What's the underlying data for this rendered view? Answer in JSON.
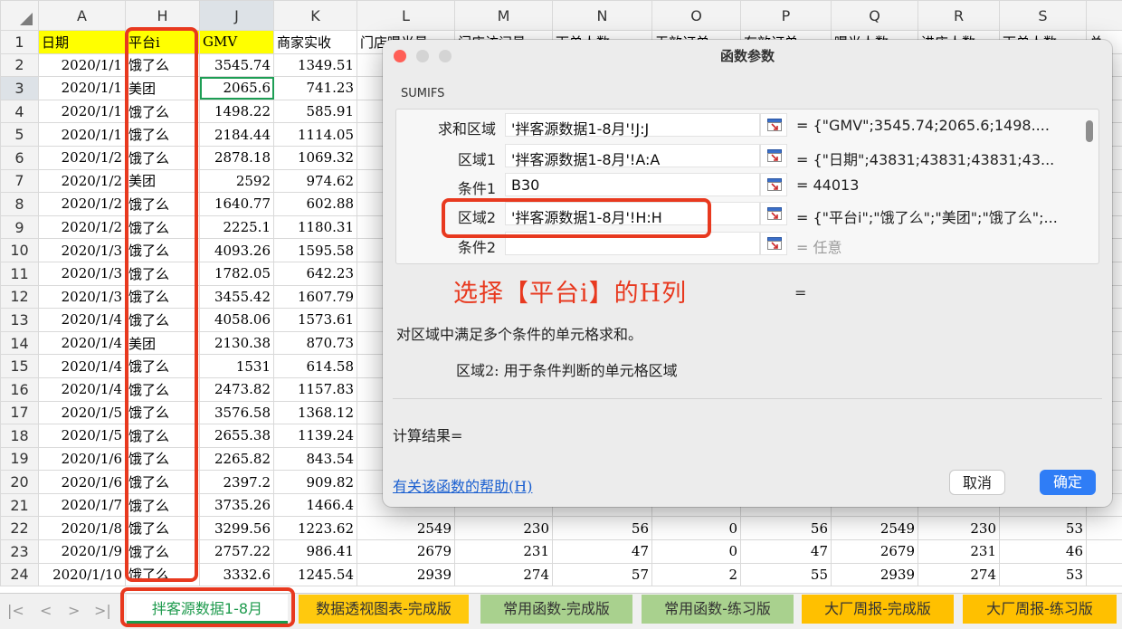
{
  "columns": [
    "A",
    "H",
    "J",
    "K",
    "L",
    "M",
    "N",
    "O",
    "P",
    "Q",
    "R",
    "S"
  ],
  "header_row": {
    "row": "1",
    "A": "日期",
    "H": "平台i",
    "J": "GMV",
    "K": "商家实收",
    "L": "门店曝光量",
    "M": "门店访问量",
    "N": "下单人数",
    "O": "无效订单",
    "P": "有效订单",
    "Q": "曝光人数",
    "R": "进店人数",
    "S": "下单人数",
    "T": "总"
  },
  "rows": [
    {
      "n": "2",
      "A": "2020/1/1",
      "H": "饿了么",
      "J": "3545.74",
      "K": "1349.51"
    },
    {
      "n": "3",
      "A": "2020/1/1",
      "H": "美团",
      "J": "2065.6",
      "K": "741.23"
    },
    {
      "n": "4",
      "A": "2020/1/1",
      "H": "饿了么",
      "J": "1498.22",
      "K": "585.91"
    },
    {
      "n": "5",
      "A": "2020/1/1",
      "H": "饿了么",
      "J": "2184.44",
      "K": "1114.05"
    },
    {
      "n": "6",
      "A": "2020/1/2",
      "H": "饿了么",
      "J": "2878.18",
      "K": "1069.32"
    },
    {
      "n": "7",
      "A": "2020/1/2",
      "H": "美团",
      "J": "2592",
      "K": "974.62"
    },
    {
      "n": "8",
      "A": "2020/1/2",
      "H": "饿了么",
      "J": "1640.77",
      "K": "602.88"
    },
    {
      "n": "9",
      "A": "2020/1/2",
      "H": "饿了么",
      "J": "2225.1",
      "K": "1180.31"
    },
    {
      "n": "10",
      "A": "2020/1/3",
      "H": "饿了么",
      "J": "4093.26",
      "K": "1595.58"
    },
    {
      "n": "11",
      "A": "2020/1/3",
      "H": "饿了么",
      "J": "1782.05",
      "K": "642.23"
    },
    {
      "n": "12",
      "A": "2020/1/3",
      "H": "饿了么",
      "J": "3455.42",
      "K": "1607.79"
    },
    {
      "n": "13",
      "A": "2020/1/4",
      "H": "饿了么",
      "J": "4058.06",
      "K": "1573.61"
    },
    {
      "n": "14",
      "A": "2020/1/4",
      "H": "美团",
      "J": "2130.38",
      "K": "870.73"
    },
    {
      "n": "15",
      "A": "2020/1/4",
      "H": "饿了么",
      "J": "1531",
      "K": "614.58"
    },
    {
      "n": "16",
      "A": "2020/1/4",
      "H": "饿了么",
      "J": "2473.82",
      "K": "1157.83"
    },
    {
      "n": "17",
      "A": "2020/1/5",
      "H": "饿了么",
      "J": "3576.58",
      "K": "1368.12"
    },
    {
      "n": "18",
      "A": "2020/1/5",
      "H": "饿了么",
      "J": "2655.38",
      "K": "1139.24"
    },
    {
      "n": "19",
      "A": "2020/1/6",
      "H": "饿了么",
      "J": "2265.82",
      "K": "843.54"
    },
    {
      "n": "20",
      "A": "2020/1/6",
      "H": "饿了么",
      "J": "2397.2",
      "K": "909.82"
    },
    {
      "n": "21",
      "A": "2020/1/7",
      "H": "饿了么",
      "J": "3735.26",
      "K": "1466.4",
      "L": "",
      "M": "",
      "N": "",
      "O": "",
      "P": "",
      "Q": "",
      "R": "",
      "S": ""
    },
    {
      "n": "22",
      "A": "2020/1/8",
      "H": "饿了么",
      "J": "3299.56",
      "K": "1223.62",
      "L": "2549",
      "M": "230",
      "N": "56",
      "O": "0",
      "P": "56",
      "Q": "2549",
      "R": "230",
      "S": "53"
    },
    {
      "n": "23",
      "A": "2020/1/9",
      "H": "饿了么",
      "J": "2757.22",
      "K": "986.41",
      "L": "2679",
      "M": "231",
      "N": "47",
      "O": "0",
      "P": "47",
      "Q": "2679",
      "R": "231",
      "S": "46"
    },
    {
      "n": "24",
      "A": "2020/1/10",
      "H": "饿了么",
      "J": "3332.6",
      "K": "1245.54",
      "L": "2939",
      "M": "274",
      "N": "57",
      "O": "2",
      "P": "55",
      "Q": "2939",
      "R": "274",
      "S": "53"
    }
  ],
  "dialog": {
    "title": "函数参数",
    "function_name": "SUMIFS",
    "args": [
      {
        "label": "求和区域",
        "value": "'拌客源数据1-8月'!J:J",
        "result": "= {\"GMV\";3545.74;2065.6;1498...."
      },
      {
        "label": "区域1",
        "value": "'拌客源数据1-8月'!A:A",
        "result": "= {\"日期\";43831;43831;43831;43..."
      },
      {
        "label": "条件1",
        "value": "B30",
        "result": "= 44013"
      },
      {
        "label": "区域2",
        "value": "'拌客源数据1-8月'!H:H",
        "result": "= {\"平台i\";\"饿了么\";\"美团\";\"饿了么\";..."
      },
      {
        "label": "条件2",
        "value": "",
        "result": "= 任意"
      }
    ],
    "equals": "=",
    "description": "对区域中满足多个条件的单元格求和。",
    "arg_help": "区域2: 用于条件判断的单元格区域",
    "calc_result": "计算结果=",
    "help_link": "有关该函数的帮助(H)",
    "cancel_label": "取消",
    "ok_label": "确定"
  },
  "annotation": "选择【平台i】的H列",
  "sheet_tabs": [
    "拌客源数据1-8月",
    "数据透视图表-完成版",
    "常用函数-完成版",
    "常用函数-练习版",
    "大厂周报-完成版",
    "大厂周报-练习版"
  ],
  "nav_icons": [
    "first-sheet-icon",
    "prev-sheet-icon",
    "next-sheet-icon",
    "last-sheet-icon"
  ],
  "colors": {
    "highlight": "#e8391f",
    "header_yellow": "#ffff00",
    "accent_blue": "#2f7df6",
    "active_green": "#1d9a4c"
  }
}
